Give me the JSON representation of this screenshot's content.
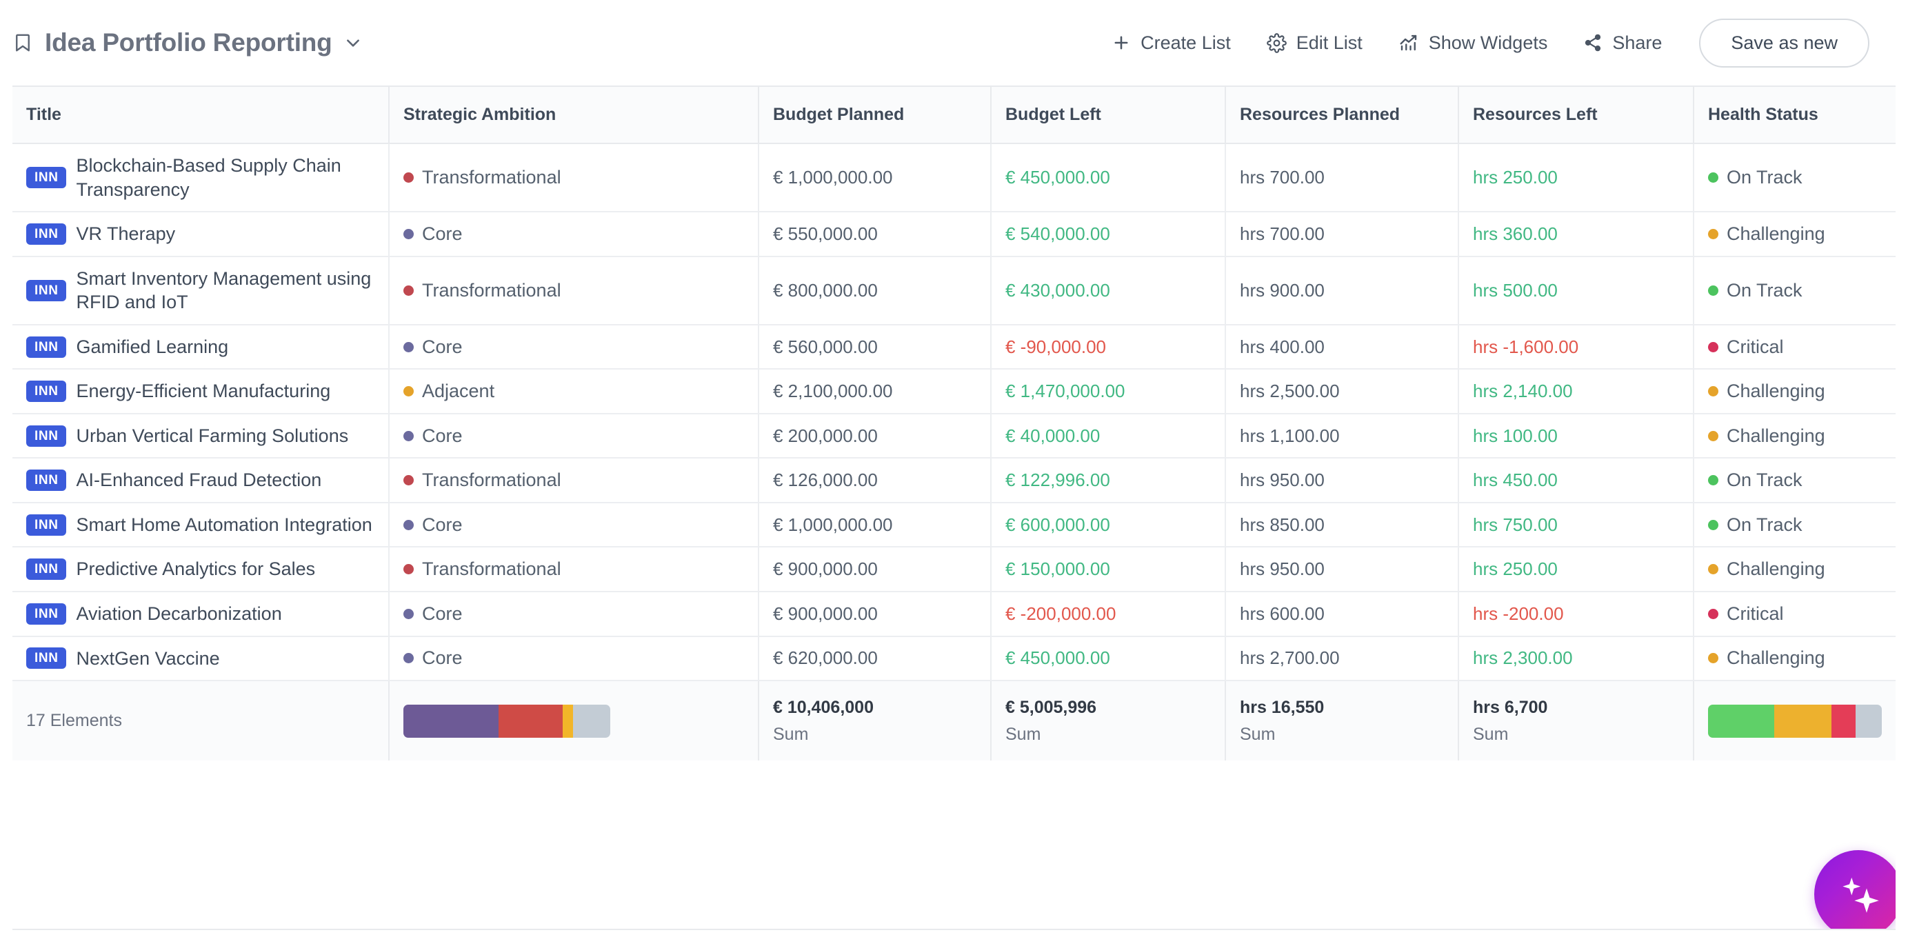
{
  "header": {
    "bookmark_icon": "bookmark-icon",
    "title": "Idea Portfolio Reporting",
    "chevron_icon": "chevron-down-icon",
    "actions": [
      {
        "icon": "plus-icon",
        "label": "Create List"
      },
      {
        "icon": "gear-icon",
        "label": "Edit List"
      },
      {
        "icon": "chart-trend-icon",
        "label": "Show Widgets"
      },
      {
        "icon": "share-icon",
        "label": "Share"
      }
    ],
    "save_as_new": "Save as new"
  },
  "table": {
    "columns": [
      "Title",
      "Strategic Ambition",
      "Budget Planned",
      "Budget Left",
      "Resources Planned",
      "Resources Left",
      "Health Status"
    ],
    "badge": "INN",
    "rows": [
      {
        "title": "Blockchain-Based Supply Chain Transparency",
        "ambition": "Transformational",
        "ambition_color": "#c0484f",
        "budget_planned": "€ 1,000,000.00",
        "budget_left": "€ 450,000.00",
        "budget_left_sign": "pos",
        "resources_planned": "hrs 700.00",
        "resources_left": "hrs 250.00",
        "resources_left_sign": "pos",
        "health": "On Track",
        "health_color": "#4cc35e"
      },
      {
        "title": "VR Therapy",
        "ambition": "Core",
        "ambition_color": "#6b6a9e",
        "budget_planned": "€ 550,000.00",
        "budget_left": "€ 540,000.00",
        "budget_left_sign": "pos",
        "resources_planned": "hrs 700.00",
        "resources_left": "hrs 360.00",
        "resources_left_sign": "pos",
        "health": "Challenging",
        "health_color": "#e5a32a"
      },
      {
        "title": "Smart Inventory Management using RFID and IoT",
        "ambition": "Transformational",
        "ambition_color": "#c0484f",
        "budget_planned": "€ 800,000.00",
        "budget_left": "€ 430,000.00",
        "budget_left_sign": "pos",
        "resources_planned": "hrs 900.00",
        "resources_left": "hrs 500.00",
        "resources_left_sign": "pos",
        "health": "On Track",
        "health_color": "#4cc35e"
      },
      {
        "title": "Gamified Learning",
        "ambition": "Core",
        "ambition_color": "#6b6a9e",
        "budget_planned": "€ 560,000.00",
        "budget_left": "€ -90,000.00",
        "budget_left_sign": "neg",
        "resources_planned": "hrs 400.00",
        "resources_left": "hrs -1,600.00",
        "resources_left_sign": "neg",
        "health": "Critical",
        "health_color": "#d6315a"
      },
      {
        "title": "Energy-Efficient Manufacturing",
        "ambition": "Adjacent",
        "ambition_color": "#e5a32a",
        "budget_planned": "€ 2,100,000.00",
        "budget_left": "€ 1,470,000.00",
        "budget_left_sign": "pos",
        "resources_planned": "hrs 2,500.00",
        "resources_left": "hrs 2,140.00",
        "resources_left_sign": "pos",
        "health": "Challenging",
        "health_color": "#e5a32a"
      },
      {
        "title": "Urban Vertical Farming Solutions",
        "ambition": "Core",
        "ambition_color": "#6b6a9e",
        "budget_planned": "€ 200,000.00",
        "budget_left": "€ 40,000.00",
        "budget_left_sign": "pos",
        "resources_planned": "hrs 1,100.00",
        "resources_left": "hrs 100.00",
        "resources_left_sign": "pos",
        "health": "Challenging",
        "health_color": "#e5a32a"
      },
      {
        "title": "AI-Enhanced Fraud Detection",
        "ambition": "Transformational",
        "ambition_color": "#c0484f",
        "budget_planned": "€ 126,000.00",
        "budget_left": "€ 122,996.00",
        "budget_left_sign": "pos",
        "resources_planned": "hrs 950.00",
        "resources_left": "hrs 450.00",
        "resources_left_sign": "pos",
        "health": "On Track",
        "health_color": "#4cc35e"
      },
      {
        "title": "Smart Home Automation Integration",
        "ambition": "Core",
        "ambition_color": "#6b6a9e",
        "budget_planned": "€ 1,000,000.00",
        "budget_left": "€ 600,000.00",
        "budget_left_sign": "pos",
        "resources_planned": "hrs 850.00",
        "resources_left": "hrs 750.00",
        "resources_left_sign": "pos",
        "health": "On Track",
        "health_color": "#4cc35e"
      },
      {
        "title": "Predictive Analytics for Sales",
        "ambition": "Transformational",
        "ambition_color": "#c0484f",
        "budget_planned": "€ 900,000.00",
        "budget_left": "€ 150,000.00",
        "budget_left_sign": "pos",
        "resources_planned": "hrs 950.00",
        "resources_left": "hrs 250.00",
        "resources_left_sign": "pos",
        "health": "Challenging",
        "health_color": "#e5a32a"
      },
      {
        "title": "Aviation Decarbonization",
        "ambition": "Core",
        "ambition_color": "#6b6a9e",
        "budget_planned": "€ 900,000.00",
        "budget_left": "€ -200,000.00",
        "budget_left_sign": "neg",
        "resources_planned": "hrs 600.00",
        "resources_left": "hrs -200.00",
        "resources_left_sign": "neg",
        "health": "Critical",
        "health_color": "#d6315a"
      },
      {
        "title": "NextGen Vaccine",
        "ambition": "Core",
        "ambition_color": "#6b6a9e",
        "budget_planned": "€ 620,000.00",
        "budget_left": "€ 450,000.00",
        "budget_left_sign": "pos",
        "resources_planned": "hrs 2,700.00",
        "resources_left": "hrs 2,300.00",
        "resources_left_sign": "pos",
        "health": "Challenging",
        "health_color": "#e5a32a"
      }
    ],
    "footer": {
      "elements": "17 Elements",
      "ambition_bar": [
        {
          "name": "Core",
          "color": "#6d5a96",
          "pct": 46
        },
        {
          "name": "Transformational",
          "color": "#cf4b46",
          "pct": 31
        },
        {
          "name": "Adjacent",
          "color": "#f2b529",
          "pct": 5
        },
        {
          "name": "Unset",
          "color": "#c3ccd5",
          "pct": 18
        }
      ],
      "budget_planned_sum": "€ 10,406,000",
      "budget_planned_label": "Sum",
      "budget_left_sum": "€ 5,005,996",
      "budget_left_label": "Sum",
      "resources_planned_sum": "hrs 16,550",
      "resources_planned_label": "Sum",
      "resources_left_sum": "hrs 6,700",
      "resources_left_label": "Sum",
      "health_bar": [
        {
          "name": "On Track",
          "color": "#5fd068",
          "pct": 38
        },
        {
          "name": "Challenging",
          "color": "#edb12e",
          "pct": 33
        },
        {
          "name": "Critical",
          "color": "#e43d57",
          "pct": 14
        },
        {
          "name": "Unset",
          "color": "#c3ccd5",
          "pct": 15
        }
      ]
    }
  },
  "ai_fab": {
    "icon": "sparkles-icon"
  }
}
